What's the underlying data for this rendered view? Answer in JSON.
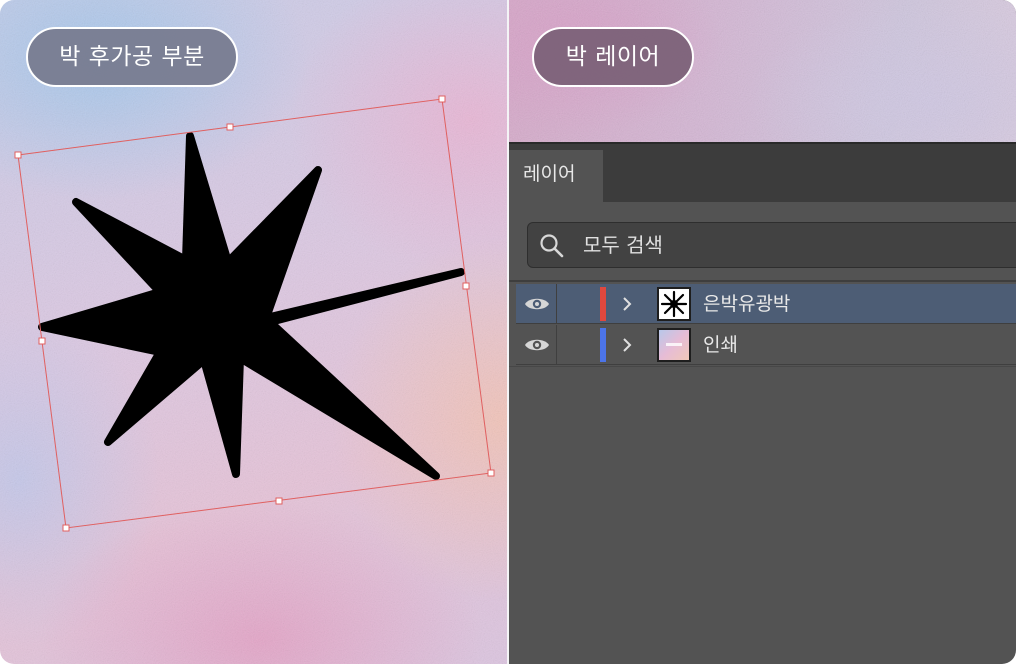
{
  "left_panel": {
    "label": "박 후가공 부분"
  },
  "right_panel": {
    "label": "박 레이어"
  },
  "layers_panel": {
    "tab_label": "레이어",
    "search": {
      "placeholder": "모두 검색"
    },
    "layers": [
      {
        "name": "은박유광박",
        "color": "#e0483e",
        "selected": true,
        "thumbnail": "star-thumbnail"
      },
      {
        "name": "인쇄",
        "color": "#4c74e8",
        "selected": false,
        "thumbnail": "print-thumbnail"
      }
    ]
  },
  "colors": {
    "selection_bbox": "#e06060",
    "selected_row": "#4d5d75",
    "panel_bg": "#535353"
  }
}
